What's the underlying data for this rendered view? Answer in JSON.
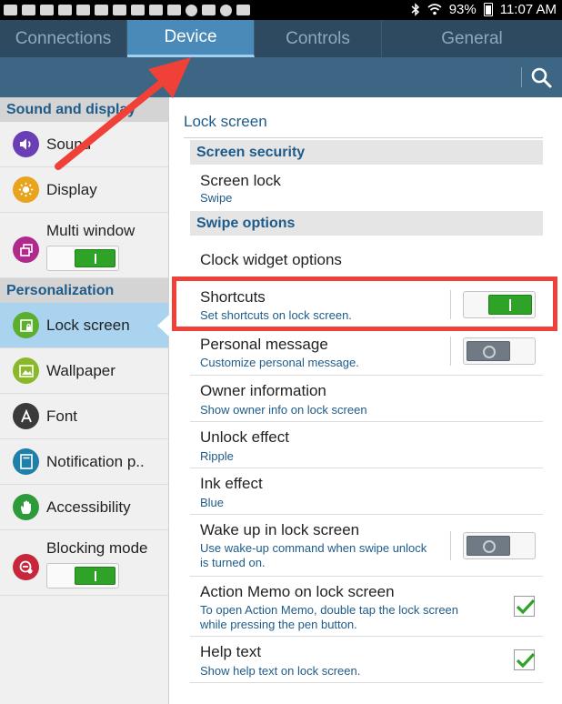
{
  "status_bar": {
    "battery": "93%",
    "time": "11:07 AM"
  },
  "tabs": [
    {
      "label": "Connections",
      "active": false
    },
    {
      "label": "Device",
      "active": true
    },
    {
      "label": "Controls",
      "active": false
    },
    {
      "label": "General",
      "active": false
    }
  ],
  "sidebar": {
    "sections": [
      {
        "title": "Sound and display",
        "items": [
          {
            "label": "Sound",
            "icon": "speaker-icon",
            "color": "#6a3fb5"
          },
          {
            "label": "Display",
            "icon": "brightness-icon",
            "color": "#e8a41c"
          },
          {
            "label": "Multi window",
            "icon": "multi-window-icon",
            "color": "#b02a8c",
            "toggle": "on"
          }
        ]
      },
      {
        "title": "Personalization",
        "items": [
          {
            "label": "Lock screen",
            "icon": "lock-screen-icon",
            "color": "#5cae2e",
            "active": true
          },
          {
            "label": "Wallpaper",
            "icon": "wallpaper-icon",
            "color": "#8ab82a"
          },
          {
            "label": "Font",
            "icon": "font-icon",
            "color": "#3a3a3a"
          },
          {
            "label": "Notification p..",
            "icon": "notification-panel-icon",
            "color": "#1e7fa8"
          },
          {
            "label": "Accessibility",
            "icon": "hand-icon",
            "color": "#2e9b3a"
          },
          {
            "label": "Blocking mode",
            "icon": "blocking-mode-icon",
            "color": "#c8263a",
            "toggle": "on"
          }
        ]
      }
    ]
  },
  "main": {
    "title": "Lock screen",
    "groups": {
      "screen_security": "Screen security",
      "swipe_options": "Swipe options"
    },
    "screen_lock": {
      "title": "Screen lock",
      "subtitle": "Swipe"
    },
    "clock_widget": {
      "title": "Clock widget options"
    },
    "shortcuts": {
      "title": "Shortcuts",
      "subtitle": "Set shortcuts on lock screen.",
      "toggle": "on"
    },
    "personal_message": {
      "title": "Personal message",
      "subtitle": "Customize personal message.",
      "toggle": "off"
    },
    "owner_information": {
      "title": "Owner information",
      "subtitle": "Show owner info on lock screen"
    },
    "unlock_effect": {
      "title": "Unlock effect",
      "subtitle": "Ripple"
    },
    "ink_effect": {
      "title": "Ink effect",
      "subtitle": "Blue"
    },
    "wake_up": {
      "title": "Wake up in lock screen",
      "subtitle_line1": "Use wake-up command when swipe unlock",
      "subtitle_line2": "is turned on.",
      "toggle": "off"
    },
    "action_memo": {
      "title": "Action Memo on lock screen",
      "subtitle_line1": "To open Action Memo, double tap the lock screen",
      "subtitle_line2": "while pressing the pen button.",
      "checked": true
    },
    "help_text": {
      "title": "Help text",
      "subtitle": "Show help text on lock screen.",
      "checked": true
    }
  },
  "annotations": {
    "highlight_color": "#ef4137",
    "arrow_color": "#ef4137"
  }
}
